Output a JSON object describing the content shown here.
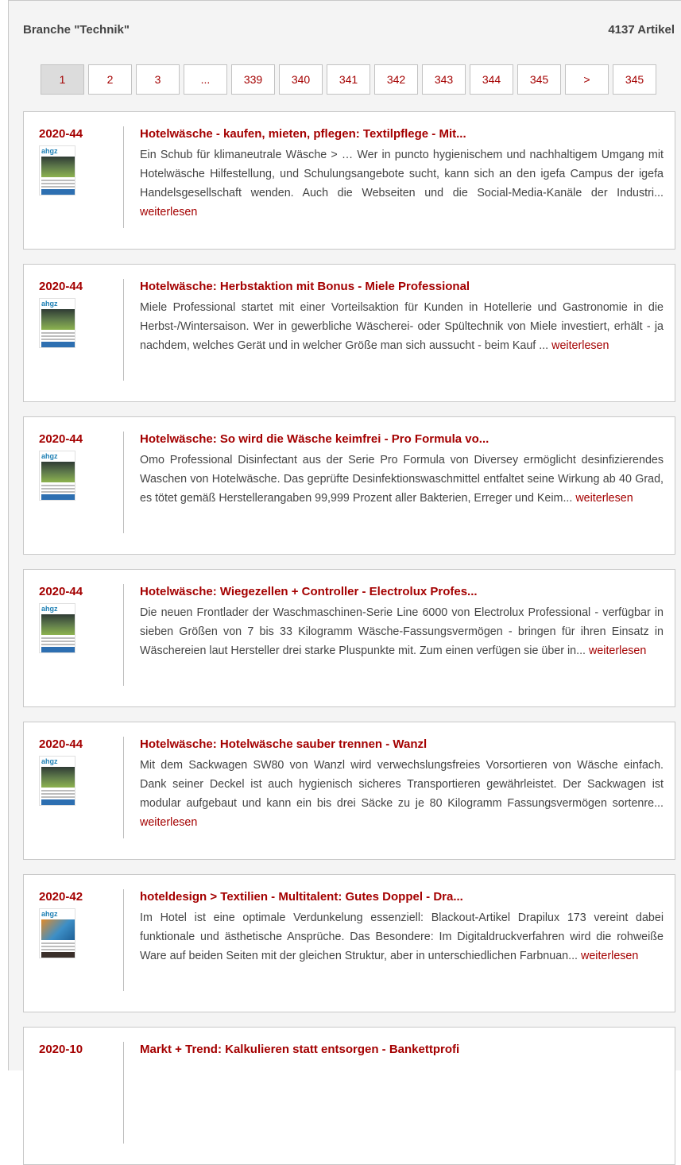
{
  "header": {
    "title": "Branche \"Technik\"",
    "count": "4137 Artikel"
  },
  "pagination": [
    {
      "label": "1",
      "active": true
    },
    {
      "label": "2"
    },
    {
      "label": "3"
    },
    {
      "label": "..."
    },
    {
      "label": "339"
    },
    {
      "label": "340"
    },
    {
      "label": "341"
    },
    {
      "label": "342"
    },
    {
      "label": "343"
    },
    {
      "label": "344"
    },
    {
      "label": "345"
    },
    {
      "label": ">"
    },
    {
      "label": "345"
    }
  ],
  "more_label": "weiterlesen",
  "articles": [
    {
      "issue": "2020-44",
      "cover": "lockdown",
      "title": "Hotelwäsche - kaufen, mieten, pflegen: Textilpflege - Mit...",
      "text": "Ein Schub für klimaneutrale Wäsche > … Wer in puncto hygienischem und nachhaltigem Umgang mit Hotelwäsche Hilfestellung, und Schulungsangebote sucht, kann sich an den igefa Campus der igefa Handelsgesellschaft wenden. Auch die Webseiten und die Social-Media-Kanäle der Industri..."
    },
    {
      "issue": "2020-44",
      "cover": "lockdown",
      "title": "Hotelwäsche: Herbstaktion mit Bonus - Miele Professional",
      "text": "Miele Professional startet mit einer Vorteilsaktion für Kunden in Hotellerie und Gastronomie in die Herbst-/Wintersaison. Wer in gewerbliche Wäscherei- oder Spültechnik von Miele investiert, erhält - ja nachdem, welches Gerät und in welcher Größe man sich aussucht - beim Kauf ..."
    },
    {
      "issue": "2020-44",
      "cover": "lockdown",
      "title": "Hotelwäsche: So wird die Wäsche keimfrei - Pro Formula vo...",
      "text": "Omo Professional Disinfectant aus der Serie Pro Formula von Diversey ermöglicht desinfizierendes Waschen von Hotelwäsche. Das geprüfte Desinfektionswaschmittel entfaltet seine Wirkung ab 40 Grad, es tötet gemäß Herstellerangaben 99,999 Prozent aller Bakterien, Erreger und Keim..."
    },
    {
      "issue": "2020-44",
      "cover": "lockdown",
      "title": "Hotelwäsche: Wiegezellen + Controller - Electrolux Profes...",
      "text": "Die neuen Frontlader der Waschmaschinen-Serie Line 6000 von Electrolux Professional - verfügbar in sieben Größen von 7 bis 33 Kilogramm Wäsche-Fassungsvermögen - bringen für ihren Einsatz in Wäschereien laut Hersteller drei starke Pluspunkte mit. Zum einen verfügen sie über in..."
    },
    {
      "issue": "2020-44",
      "cover": "lockdown",
      "title": "Hotelwäsche: Hotelwäsche sauber trennen - Wanzl",
      "text": "Mit dem Sackwagen SW80 von Wanzl wird verwechslungsfreies Vorsortieren von Wäsche einfach. Dank seiner Deckel ist auch hygienisch sicheres Transportieren gewährleistet. Der Sackwagen ist modular aufgebaut und kann ein bis drei Säcke zu je 80 Kilogramm Fassungsvermögen sortenre..."
    },
    {
      "issue": "2020-42",
      "cover": "internorga",
      "title": "hoteldesign > Textilien - Multitalent: Gutes Doppel - Dra...",
      "text": "Im Hotel ist eine optimale Verdunkelung essenziell: Blackout-Artikel Drapilux 173 vereint dabei funktionale und ästhetische Ansprüche. Das Besondere: Im Digitaldruckverfahren wird die rohweiße Ware auf beiden Seiten mit der gleichen Struktur, aber in unterschiedlichen Farbnuan..."
    },
    {
      "issue": "2020-10",
      "cover": "none",
      "title": "Markt + Trend: Kalkulieren statt entsorgen - Bankettprofi",
      "text": ""
    }
  ],
  "colors": {
    "accent": "#a40000",
    "panel": "#f4f4f4",
    "border": "#c8c8c8"
  }
}
